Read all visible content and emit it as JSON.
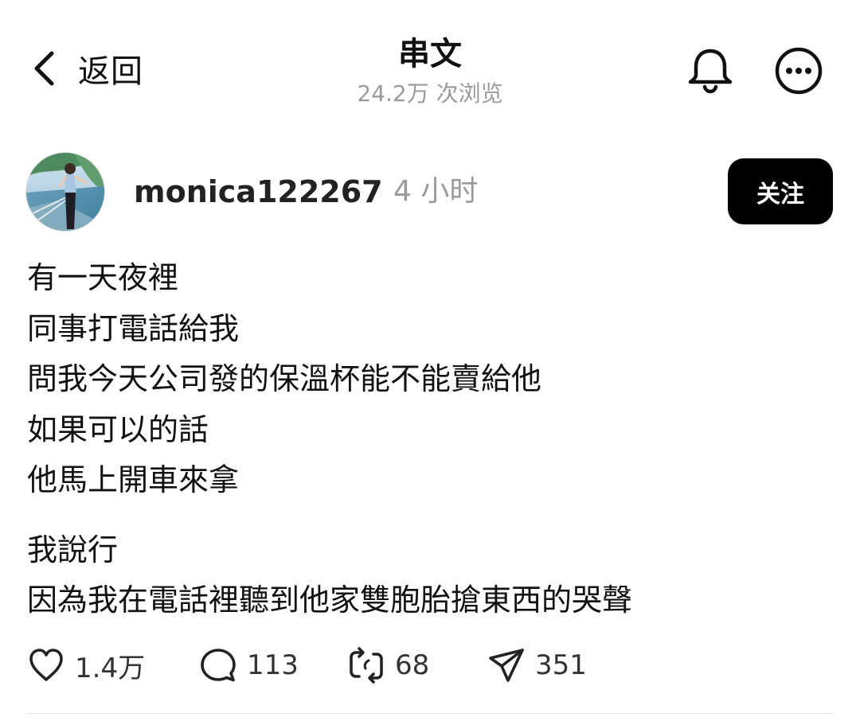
{
  "header": {
    "back_label": "返回",
    "title": "串文",
    "views": "24.2万 次浏览",
    "back_icon": "chevron-left-icon",
    "bell_icon": "bell-icon",
    "more_icon": "more-horizontal-icon"
  },
  "post": {
    "author": {
      "username": "monica122267",
      "time": "4 小时",
      "avatar": "avatar-photo"
    },
    "follow_label": "关注",
    "paragraphs": [
      [
        "有一天夜裡",
        "同事打電話給我",
        "問我今天公司發的保溫杯能不能賣給他",
        "如果可以的話",
        "他馬上開車來拿"
      ],
      [
        "我說行",
        "因為我在電話裡聽到他家雙胞胎搶東西的哭聲"
      ]
    ],
    "stats": {
      "likes": "1.4万",
      "comments": "113",
      "reposts": "68",
      "shares": "351"
    }
  },
  "colors": {
    "text": "#111111",
    "muted": "#9a9a9a",
    "button_bg": "#000000",
    "button_text": "#ffffff"
  }
}
